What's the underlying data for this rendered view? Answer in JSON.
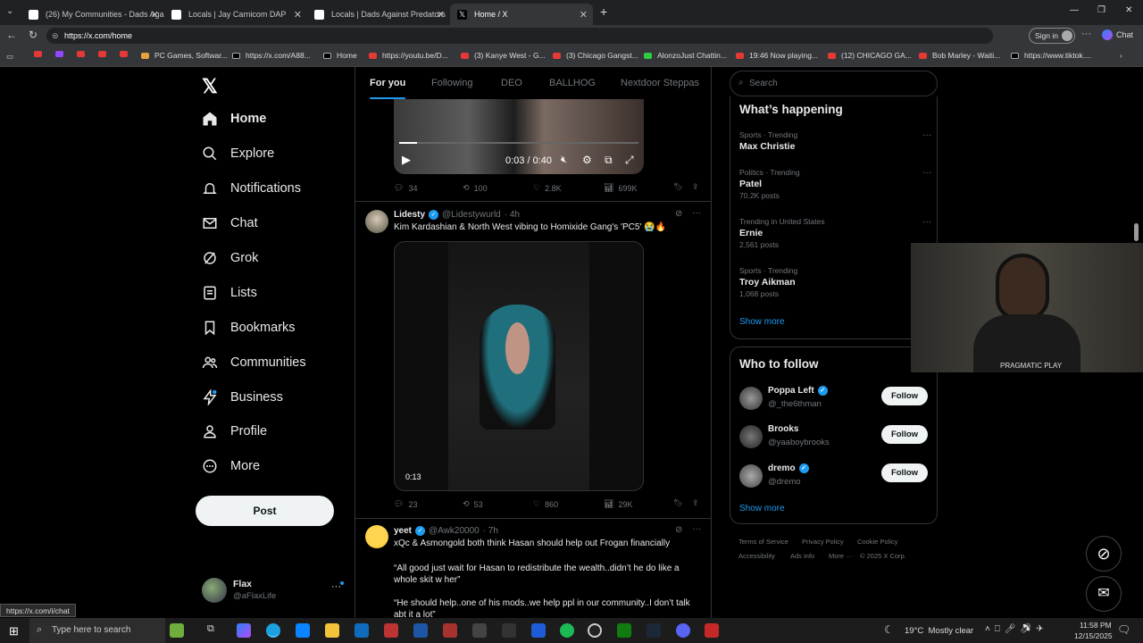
{
  "browser": {
    "tabs": [
      {
        "label": "(26) My Communities - Dads Again",
        "color": "#ffffff"
      },
      {
        "label": "Locals | Jay Carnicom DAP",
        "color": "#2b2b2b"
      },
      {
        "label": "Locals | Dads Against Predators",
        "color": "#2b2b2b"
      },
      {
        "label": "Home / X",
        "color": "#000000"
      }
    ],
    "url": "https://x.com/home",
    "signin": "Sign in",
    "chat": "Chat",
    "bookmarks": [
      "PC Games, Softwar...",
      "https://x.com/A88...",
      "Home",
      "https://youtu.be/D...",
      "(3) Kanye West - G...",
      "(3) Chicago Gangst...",
      "AlonzoJust Chattin...",
      "19:46 Now playing...",
      "(12) CHICAGO GA...",
      "Bob Marley - Waiti...",
      "https://www.tiktok...."
    ]
  },
  "nav": {
    "items": [
      "Home",
      "Explore",
      "Notifications",
      "Chat",
      "Grok",
      "Lists",
      "Bookmarks",
      "Communities",
      "Business",
      "Profile",
      "More"
    ],
    "post": "Post",
    "user_name": "Flax",
    "user_handle": "@aFlaxLife"
  },
  "feed": {
    "tabs": [
      "For you",
      "Following",
      "DEO",
      "BALLHOG",
      "Nextdoor Steppas"
    ],
    "video1": {
      "time": "0:03 / 0:40"
    },
    "stats1": [
      "34",
      "100",
      "2.8K",
      "699K"
    ],
    "post2": {
      "name": "Lidesty",
      "handle": "@Lidestywurld",
      "time": "· 4h",
      "text": "Kim Kardashian & North West vibing to Homixide Gang's 'PC5' 😭🔥",
      "video_time": "0:13",
      "stats": [
        "23",
        "53",
        "860",
        "29K"
      ]
    },
    "post3": {
      "name": "yeet",
      "handle": "@Awk20000",
      "time": "· 7h",
      "text1": "xQc & Asmongold both think Hasan should help out Frogan financially",
      "text2": "“All good just wait for Hasan to redistribute the wealth..didn’t he do like a whole skit w her”",
      "text3": "“He should help..one of his mods..we help ppl in our community..I don’t talk abt it a lot”"
    }
  },
  "right": {
    "search_placeholder": "Search",
    "whats_happening": "What’s happening",
    "trends": [
      {
        "cat": "Sports · Trending",
        "name": "Max Christie",
        "count": ""
      },
      {
        "cat": "Politics · Trending",
        "name": "Patel",
        "count": "70.2K posts"
      },
      {
        "cat": "Trending in United States",
        "name": "Ernie",
        "count": "2,561 posts"
      },
      {
        "cat": "Sports · Trending",
        "name": "Troy Aikman",
        "count": "1,068 posts"
      }
    ],
    "show_more": "Show more",
    "who_to_follow": "Who to follow",
    "follow": [
      {
        "name": "Poppa Left",
        "handle": "@_the6thman"
      },
      {
        "name": "Brooks",
        "handle": "@yaaboybrooks"
      },
      {
        "name": "dremo",
        "handle": "@dremo"
      }
    ],
    "follow_label": "Follow",
    "footer": [
      "Terms of Service",
      "Privacy Policy",
      "Cookie Policy",
      "Accessibility",
      "Ads info",
      "More ···",
      "© 2025 X Corp."
    ],
    "webcam_text": "PRAGMATIC PLAY"
  },
  "status_url": "https://x.com/i/chat",
  "taskbar": {
    "search": "Type here to search",
    "weather": "19°C  Mostly clear",
    "time": "11:58 PM",
    "date": "12/15/2025"
  }
}
